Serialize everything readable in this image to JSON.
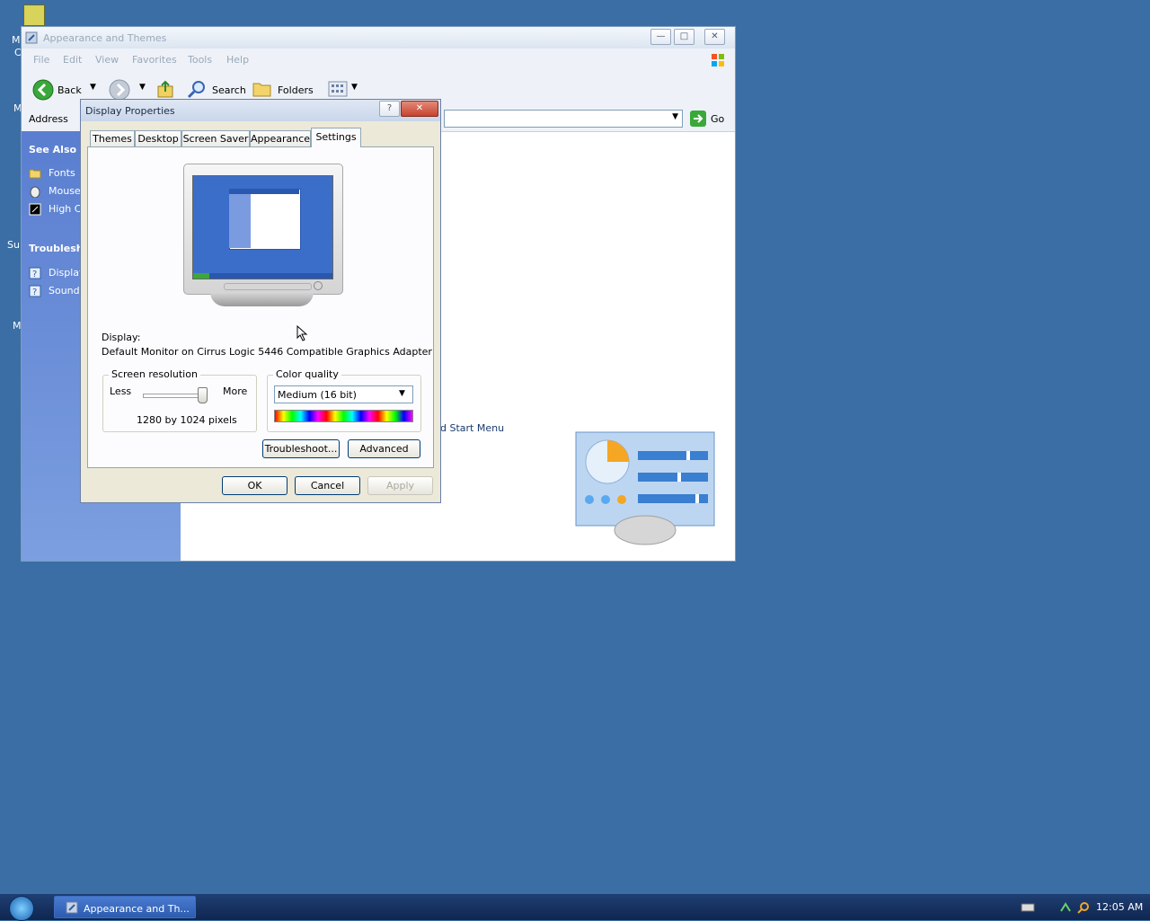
{
  "desktop": {
    "fragments": [
      "M",
      "C",
      "M",
      "Su",
      "M"
    ]
  },
  "explorer": {
    "title": "Appearance and Themes",
    "menu": [
      "File",
      "Edit",
      "View",
      "Favorites",
      "Tools",
      "Help"
    ],
    "toolbar": {
      "back": "Back",
      "search": "Search",
      "folders": "Folders"
    },
    "address_label": "Address",
    "go_label": "Go",
    "sidebar": {
      "see_also": "See Also",
      "see_also_items": [
        "Fonts",
        "Mouse",
        "High C"
      ],
      "troubleshooters": "Troublesho",
      "troubleshooter_items": [
        "Display",
        "Sound"
      ]
    },
    "content_fragment": "d Start Menu"
  },
  "dialog": {
    "title": "Display Properties",
    "tabs": [
      "Themes",
      "Desktop",
      "Screen Saver",
      "Appearance",
      "Settings"
    ],
    "active_tab": "Settings",
    "display_label": "Display:",
    "display_value": "Default Monitor on Cirrus Logic 5446 Compatible Graphics Adapter",
    "resolution": {
      "group_label": "Screen resolution",
      "less": "Less",
      "more": "More",
      "value_text": "1280 by 1024 pixels",
      "slider_level": 1.0
    },
    "color_quality": {
      "group_label": "Color quality",
      "selected": "Medium (16 bit)"
    },
    "buttons": {
      "troubleshoot": "Troubleshoot...",
      "advanced": "Advanced",
      "ok": "OK",
      "cancel": "Cancel",
      "apply": "Apply"
    }
  },
  "taskbar": {
    "task_label": "Appearance and Th...",
    "clock": "12:05 AM"
  }
}
